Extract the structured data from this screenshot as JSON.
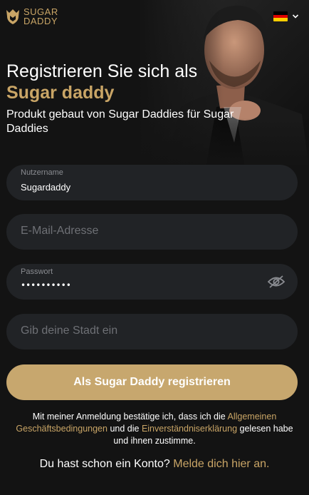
{
  "brand": {
    "logo_line1": "SUGAR",
    "logo_line2": "DADDY",
    "accent_color": "#c9a566"
  },
  "language": {
    "selected": "Deutsch",
    "flag_icon": "germany-flag-icon"
  },
  "headline": {
    "line1": "Registrieren Sie sich als",
    "accent": "Sugar daddy",
    "subtitle": "Produkt gebaut von Sugar Daddies für Sugar Daddies"
  },
  "form": {
    "username": {
      "label": "Nutzername",
      "value": "Sugardaddy"
    },
    "email": {
      "placeholder": "E-Mail-Adresse"
    },
    "password": {
      "label": "Passwort",
      "value": "••••••••••",
      "toggle_icon": "eye-slash-icon"
    },
    "city": {
      "placeholder": "Gib deine Stadt ein"
    },
    "submit_label": "Als Sugar Daddy registrieren"
  },
  "legal": {
    "text_before": "Mit meiner Anmeldung bestätige ich, dass ich die ",
    "link1": "Allgemeinen Geschäftsbedingungen",
    "text_middle": " und die ",
    "link2": "Einverständniserklärung",
    "text_after": " gelesen habe und ihnen zustimme."
  },
  "login_prompt": {
    "text": "Du hast schon ein Konto? ",
    "link": "Melde dich hier an."
  },
  "colors": {
    "background": "#131313",
    "field_bg": "#212326",
    "button_bg": "#c7a76e"
  }
}
